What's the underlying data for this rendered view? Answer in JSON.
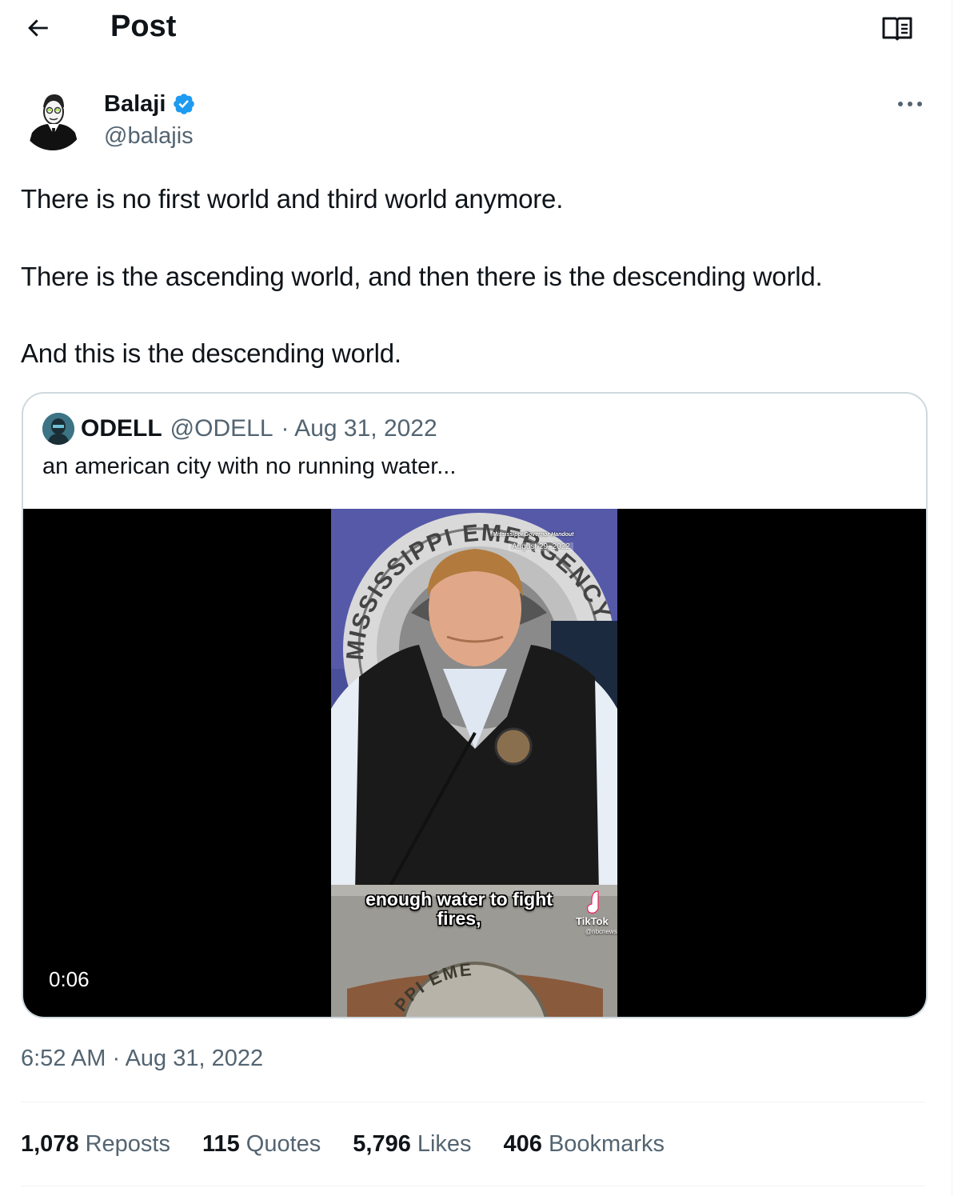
{
  "header": {
    "title": "Post",
    "back_icon": "arrow-left-icon",
    "reader_icon": "open-book-icon"
  },
  "author": {
    "name": "Balaji",
    "handle": "@balajis",
    "verified": true,
    "verified_color": "#1d9bf0"
  },
  "tweet": {
    "lines": [
      "There is no first world and third world anymore.",
      "There is the ascending world, and then there is the descending world.",
      "And this is the descending world."
    ],
    "timestamp": "6:52 AM · Aug 31, 2022"
  },
  "quoted": {
    "name": "ODELL",
    "handle": "@ODELL",
    "date": "· Aug 31, 2022",
    "text": "an american city with no running water...",
    "video": {
      "duration": "0:06",
      "caption_line1": "enough water to fight",
      "caption_line2": "fires,",
      "watermark": "TikTok",
      "watermark_handle": "@nbcnews",
      "handout_label": "Mississippi Governor Handout",
      "handout_date": "August 29, 2022",
      "seal_text_top": "MISSISSIPPI EMERGENCY",
      "seal_text_bottom": "PPI EME"
    }
  },
  "stats": [
    {
      "num": "1,078",
      "label": "Reposts"
    },
    {
      "num": "115",
      "label": "Quotes"
    },
    {
      "num": "5,796",
      "label": "Likes"
    },
    {
      "num": "406",
      "label": "Bookmarks"
    }
  ]
}
